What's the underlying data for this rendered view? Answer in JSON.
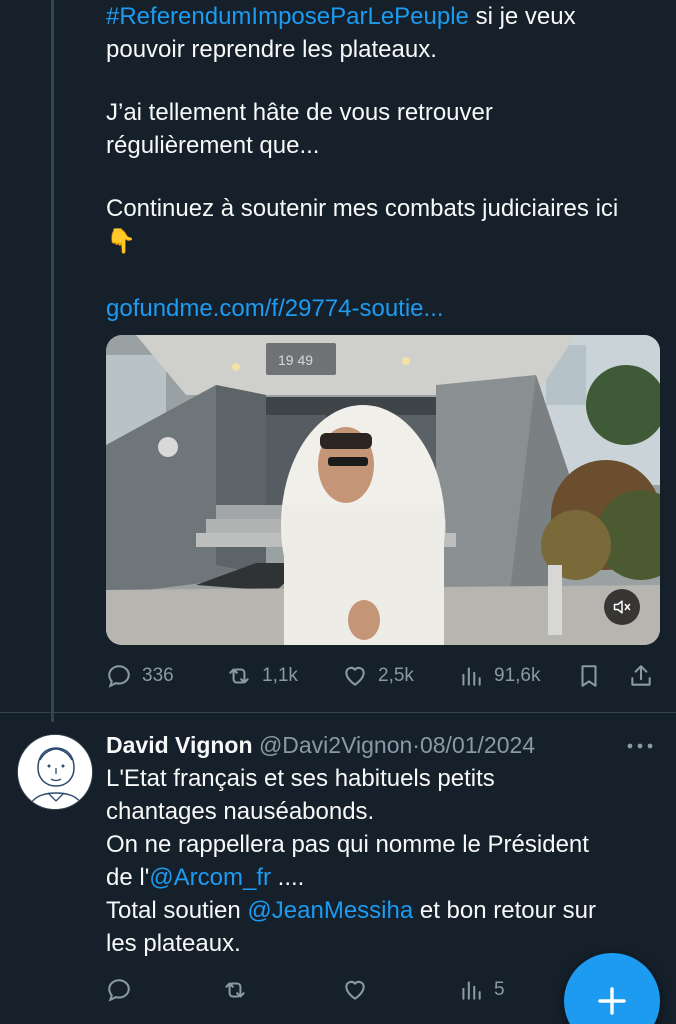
{
  "tweet1": {
    "hashtag": "#ReferendumImposeParLePeuple",
    "line1_rest": " si je veux",
    "line2": "pouvoir reprendre les plateaux.",
    "para2_line1": "J’ai tellement hâte de vous retrouver",
    "para2_line2": "régulièrement que...",
    "para3": "Continuez à soutenir mes combats judiciaires ici",
    "emoji": "👇",
    "link": "gofundme.com/f/29774-soutie...",
    "media": {
      "building_number": "19 49",
      "mute_icon": "speaker-muted-icon"
    },
    "actions": {
      "replies": "336",
      "reposts": "1,1k",
      "likes": "2,5k",
      "views": "91,6k"
    }
  },
  "tweet2": {
    "name": "David Vignon",
    "handle": "@Davi2Vignon",
    "separator": "·",
    "date": "08/01/2024",
    "text_line1": "L'Etat français et ses habituels petits",
    "text_line2": "chantages nauséabonds.",
    "text_line3": "On ne rappellera pas qui nomme le Président",
    "text_line4_prefix": "de l'",
    "mention1": "@Arcom_fr",
    "text_line4_suffix": " ....",
    "text_line5_prefix": "Total soutien ",
    "mention2": "@JeanMessiha",
    "text_line5_suffix": " et bon retour sur",
    "text_line6": "les plateaux.",
    "actions": {
      "views": "5"
    }
  },
  "fab": {
    "icon": "plus-icon"
  },
  "colors": {
    "background": "#15202b",
    "accent": "#1d9bf0",
    "secondary_text": "#8b98a5",
    "divider": "#38444d"
  }
}
